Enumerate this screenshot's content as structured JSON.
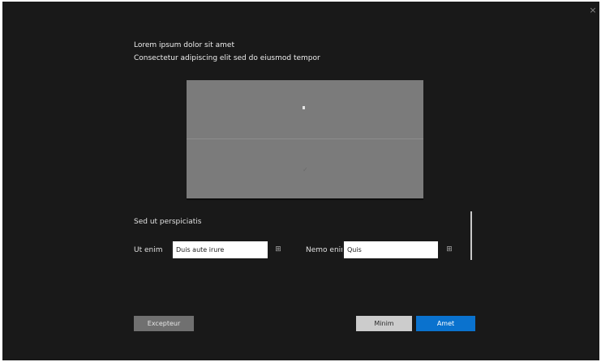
{
  "dialog": {
    "close_glyph": "×",
    "heading_line_1": "Lorem ipsum dolor sit amet",
    "heading_line_2": "Consectetur adipiscing elit sed do eiusmod tempor"
  },
  "preview": {
    "glyph": "✓"
  },
  "section": {
    "label": "Sed ut perspiciatis"
  },
  "fields": [
    {
      "label": "Ut enim",
      "value": "Duis aute irure",
      "stepper_glyph": "⊞"
    },
    {
      "label": "Nemo enim",
      "value": "Quis",
      "stepper_glyph": "⊞"
    }
  ],
  "buttons": {
    "left_label": "Excepteur",
    "cancel_label": "Minim",
    "ok_label": "Amet"
  },
  "colors": {
    "background": "#191919",
    "preview": "#7b7b7b",
    "accent": "#0a72ce"
  }
}
